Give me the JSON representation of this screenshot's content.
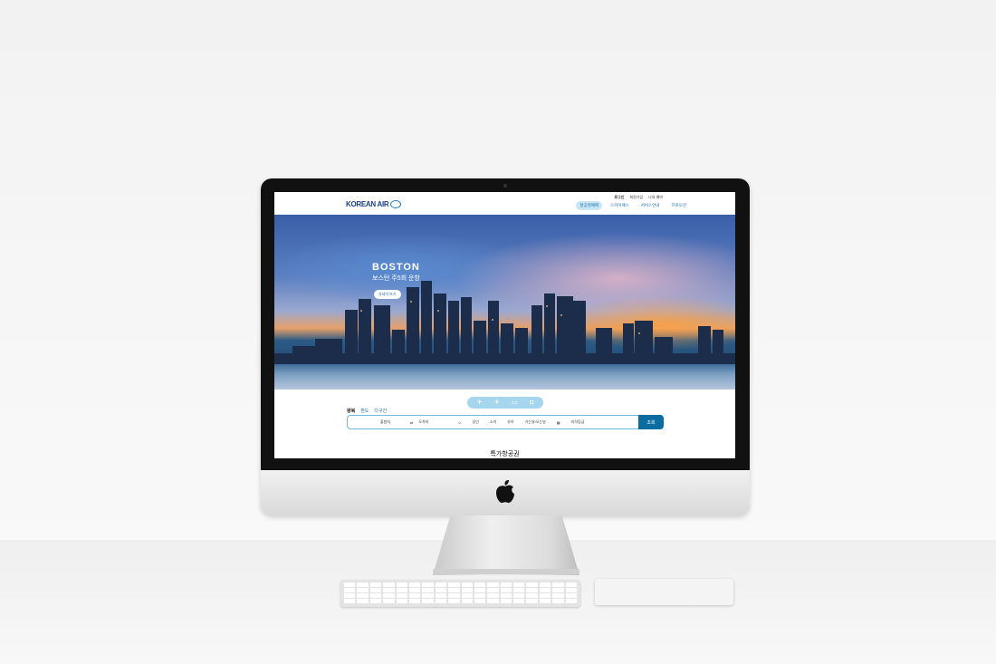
{
  "site": {
    "logo_text": "KOREAN AIR",
    "utility_links": [
      "로그인",
      "회원가입",
      "나의 예약"
    ],
    "nav": [
      {
        "label": "항공권예매",
        "active": true
      },
      {
        "label": "스카이패스",
        "active": false
      },
      {
        "label": "서비스안내",
        "active": false
      },
      {
        "label": "프로모션",
        "active": false
      }
    ],
    "hero": {
      "title": "BOSTON",
      "subtitle": "보스턴 주5회 운항",
      "button_label": "자세히 보기"
    },
    "booking_modes": [
      "flight-icon",
      "flight-alt-icon",
      "hotel-icon",
      "car-icon"
    ],
    "trip_types": [
      "왕복",
      "편도",
      "다구간"
    ],
    "search": {
      "origin_label": "출발지",
      "swap_icon": "swap-icon",
      "destination_label": "도착지",
      "passengers_icon": "person-icon",
      "adult_label": "성인",
      "child_label": "소아",
      "infant_label": "유아",
      "date_label": "가는날/오는날",
      "cabin_label": "좌석등급",
      "submit_label": "조회"
    },
    "section_title": "특가항공권",
    "colors": {
      "brand": "#1a3f8b",
      "accent": "#0b6d9f",
      "highlight": "#c9e6f5"
    }
  }
}
